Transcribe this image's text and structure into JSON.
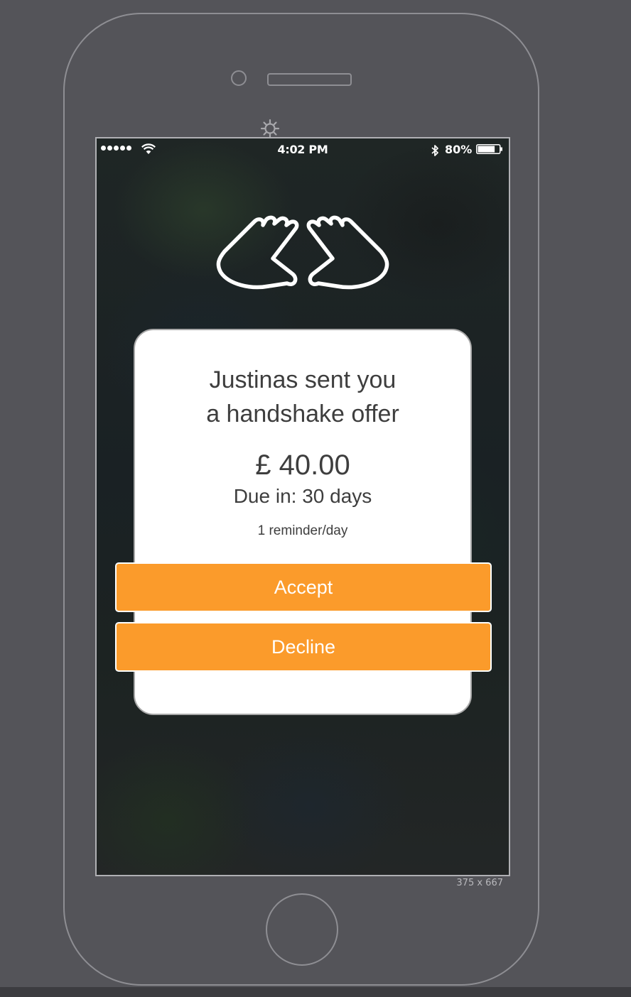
{
  "status_bar": {
    "time": "4:02 PM",
    "battery_percent": "80%",
    "battery_level": 0.8,
    "signal_bars": 5
  },
  "device": {
    "size_label": "375 x 667"
  },
  "offer": {
    "title": "Justinas sent you\na handshake offer",
    "amount": "£ 40.00",
    "due": "Due in: 30 days",
    "reminder": "1 reminder/day"
  },
  "actions": {
    "accept_label": "Accept",
    "decline_label": "Decline"
  },
  "colors": {
    "accent": "#fb9b2b",
    "card_background": "#ffffff",
    "text": "#3e3e3e",
    "device_background": "#545459"
  },
  "icons": {
    "hands": "hands-icon",
    "settings": "gear-icon",
    "wifi": "wifi-icon",
    "bluetooth": "bluetooth-icon",
    "battery": "battery-icon"
  }
}
